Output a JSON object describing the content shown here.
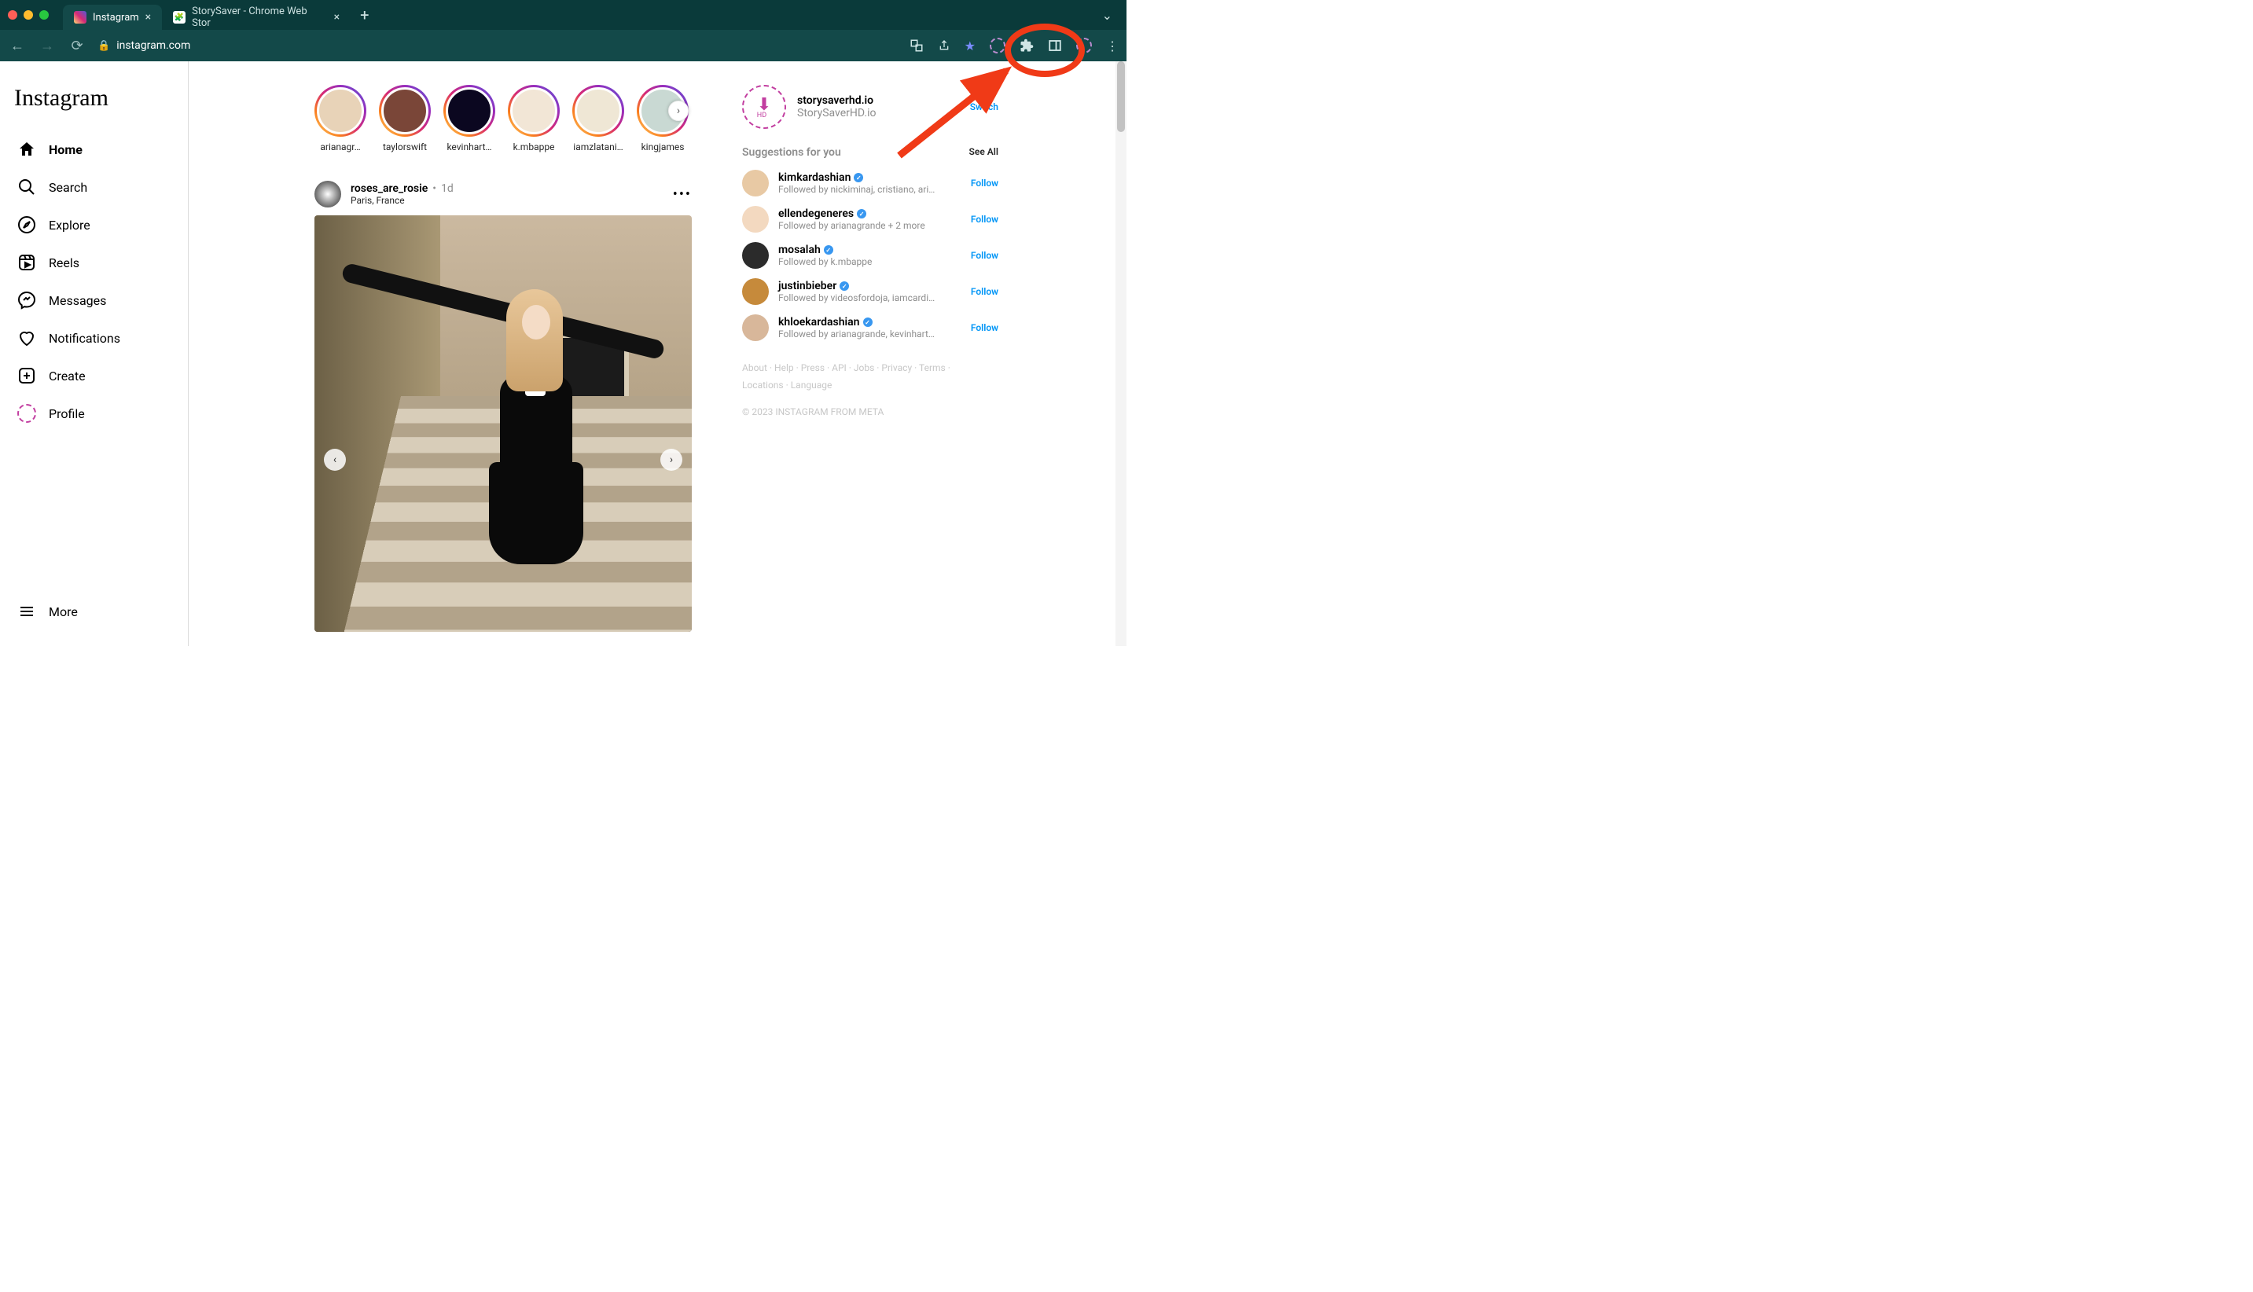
{
  "browser": {
    "tabs": [
      {
        "title": "Instagram",
        "active": true
      },
      {
        "title": "StorySaver - Chrome Web Stor",
        "active": false
      }
    ],
    "url": "instagram.com"
  },
  "sidebar": {
    "logo": "Instagram",
    "items": [
      {
        "label": "Home",
        "icon": "home",
        "active": true
      },
      {
        "label": "Search",
        "icon": "search",
        "active": false
      },
      {
        "label": "Explore",
        "icon": "explore",
        "active": false
      },
      {
        "label": "Reels",
        "icon": "reels",
        "active": false
      },
      {
        "label": "Messages",
        "icon": "messages",
        "active": false
      },
      {
        "label": "Notifications",
        "icon": "heart",
        "active": false
      },
      {
        "label": "Create",
        "icon": "create",
        "active": false
      },
      {
        "label": "Profile",
        "icon": "profile",
        "active": false
      }
    ],
    "more": "More"
  },
  "stories": [
    {
      "username": "arianagr…"
    },
    {
      "username": "taylorswift"
    },
    {
      "username": "kevinhart…"
    },
    {
      "username": "k.mbappe"
    },
    {
      "username": "iamzlatani…"
    },
    {
      "username": "kingjames"
    }
  ],
  "post": {
    "username": "roses_are_rosie",
    "time": "1d",
    "location": "Paris, France"
  },
  "rail": {
    "account": {
      "username": "storysaverhd.io",
      "display": "StorySaverHD.io",
      "switch": "Switch"
    },
    "sugg_label": "Suggestions for you",
    "see_all": "See All",
    "suggestions": [
      {
        "username": "kimkardashian",
        "sub": "Followed by nickiminaj, cristiano, aria…",
        "action": "Follow"
      },
      {
        "username": "ellendegeneres",
        "sub": "Followed by arianagrande + 2 more",
        "action": "Follow"
      },
      {
        "username": "mosalah",
        "sub": "Followed by k.mbappe",
        "action": "Follow"
      },
      {
        "username": "justinbieber",
        "sub": "Followed by videosfordoja, iamcardib …",
        "action": "Follow"
      },
      {
        "username": "khloekardashian",
        "sub": "Followed by arianagrande, kevinhart4…",
        "action": "Follow"
      }
    ],
    "footer_links": [
      "About",
      "Help",
      "Press",
      "API",
      "Jobs",
      "Privacy",
      "Terms",
      "Locations",
      "Language"
    ],
    "copyright": "© 2023 INSTAGRAM FROM META"
  }
}
